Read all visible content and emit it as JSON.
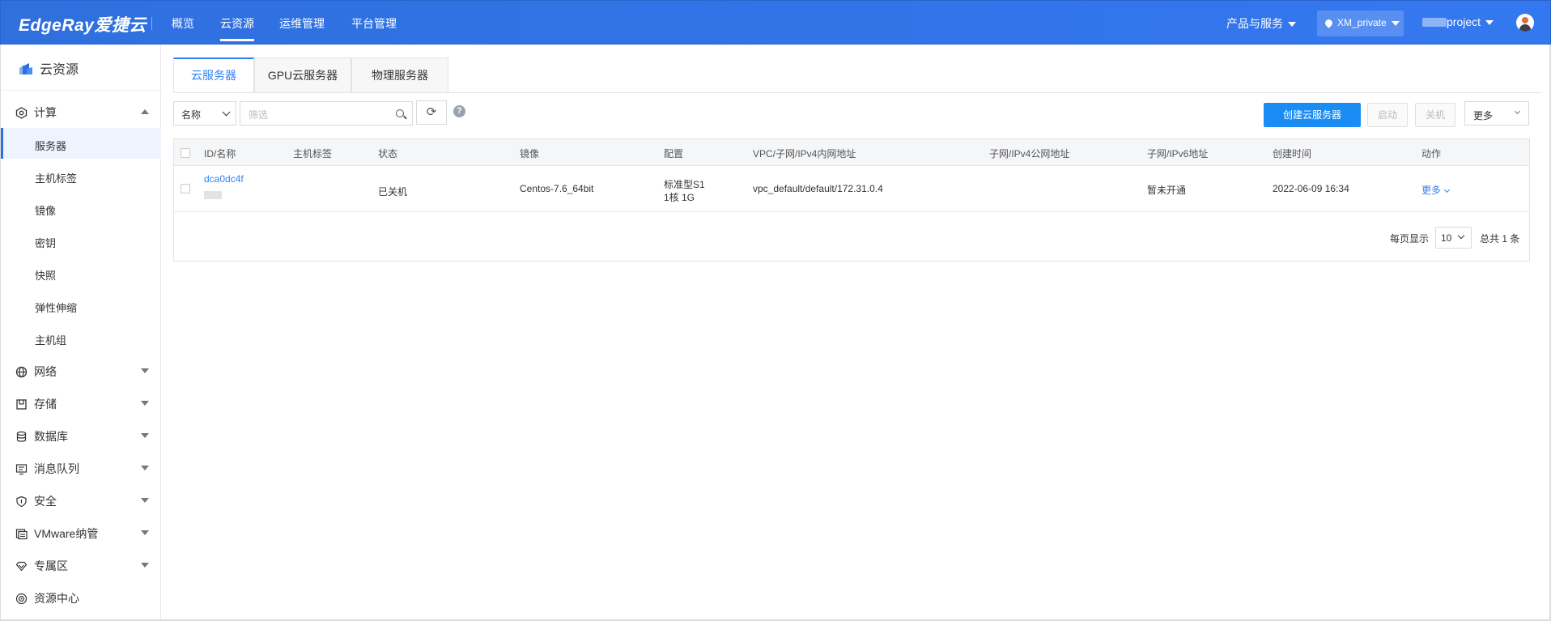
{
  "header": {
    "logo": "EdgeRay爱捷云",
    "nav": [
      "概览",
      "云资源",
      "运维管理",
      "平台管理"
    ],
    "active_nav": "云资源",
    "products": "产品与服务",
    "region": "XM_private",
    "project": "project",
    "colors": {
      "bar": "#3478f0",
      "accent": "#2f82f5",
      "primary_button": "#1a8cf3"
    }
  },
  "sidebar": {
    "title": "云资源",
    "compute": "计算",
    "compute_items": [
      "服务器",
      "主机标签",
      "镜像",
      "密钥",
      "快照",
      "弹性伸缩",
      "主机组"
    ],
    "groups": [
      "网络",
      "存储",
      "数据库",
      "消息队列",
      "安全",
      "VMware纳管",
      "专属区",
      "资源中心"
    ]
  },
  "tabs": [
    "云服务器",
    "GPU云服务器",
    "物理服务器"
  ],
  "toolbar": {
    "filter_select": "名称",
    "search_placeholder": "筛选",
    "help": "?",
    "create": "创建云服务器",
    "start": "启动",
    "stop": "关机",
    "more": "更多"
  },
  "table": {
    "columns": [
      "ID/名称",
      "主机标签",
      "状态",
      "镜像",
      "配置",
      "VPC/子网/IPv4内网地址",
      "子网/IPv4公网地址",
      "子网/IPv6地址",
      "创建时间",
      "动作"
    ],
    "rows": [
      {
        "id": "dca0dc4f",
        "tag": "",
        "status": "已关机",
        "image": "Centos-7.6_64bit",
        "config_line1": "标准型S1",
        "config_line2": "1核 1G",
        "vpc": "vpc_default/default/172.31.0.4",
        "public": "",
        "ipv6": "暂未开通",
        "created": "2022-06-09 16:34",
        "action": "更多"
      }
    ]
  },
  "pagination": {
    "per_page_label": "每页显示",
    "per_page": "10",
    "total": "总共 1 条"
  }
}
